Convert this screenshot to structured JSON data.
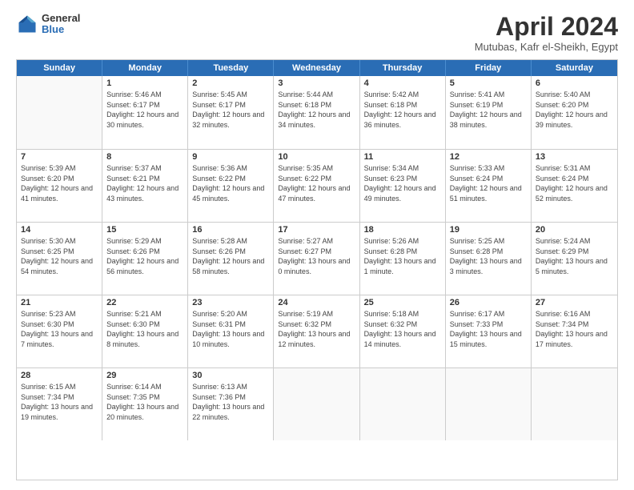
{
  "logo": {
    "general": "General",
    "blue": "Blue"
  },
  "title": "April 2024",
  "subtitle": "Mutubas, Kafr el-Sheikh, Egypt",
  "days": [
    "Sunday",
    "Monday",
    "Tuesday",
    "Wednesday",
    "Thursday",
    "Friday",
    "Saturday"
  ],
  "weeks": [
    [
      {
        "day": "",
        "sunrise": "",
        "sunset": "",
        "daylight": ""
      },
      {
        "day": "1",
        "sunrise": "Sunrise: 5:46 AM",
        "sunset": "Sunset: 6:17 PM",
        "daylight": "Daylight: 12 hours and 30 minutes."
      },
      {
        "day": "2",
        "sunrise": "Sunrise: 5:45 AM",
        "sunset": "Sunset: 6:17 PM",
        "daylight": "Daylight: 12 hours and 32 minutes."
      },
      {
        "day": "3",
        "sunrise": "Sunrise: 5:44 AM",
        "sunset": "Sunset: 6:18 PM",
        "daylight": "Daylight: 12 hours and 34 minutes."
      },
      {
        "day": "4",
        "sunrise": "Sunrise: 5:42 AM",
        "sunset": "Sunset: 6:18 PM",
        "daylight": "Daylight: 12 hours and 36 minutes."
      },
      {
        "day": "5",
        "sunrise": "Sunrise: 5:41 AM",
        "sunset": "Sunset: 6:19 PM",
        "daylight": "Daylight: 12 hours and 38 minutes."
      },
      {
        "day": "6",
        "sunrise": "Sunrise: 5:40 AM",
        "sunset": "Sunset: 6:20 PM",
        "daylight": "Daylight: 12 hours and 39 minutes."
      }
    ],
    [
      {
        "day": "7",
        "sunrise": "Sunrise: 5:39 AM",
        "sunset": "Sunset: 6:20 PM",
        "daylight": "Daylight: 12 hours and 41 minutes."
      },
      {
        "day": "8",
        "sunrise": "Sunrise: 5:37 AM",
        "sunset": "Sunset: 6:21 PM",
        "daylight": "Daylight: 12 hours and 43 minutes."
      },
      {
        "day": "9",
        "sunrise": "Sunrise: 5:36 AM",
        "sunset": "Sunset: 6:22 PM",
        "daylight": "Daylight: 12 hours and 45 minutes."
      },
      {
        "day": "10",
        "sunrise": "Sunrise: 5:35 AM",
        "sunset": "Sunset: 6:22 PM",
        "daylight": "Daylight: 12 hours and 47 minutes."
      },
      {
        "day": "11",
        "sunrise": "Sunrise: 5:34 AM",
        "sunset": "Sunset: 6:23 PM",
        "daylight": "Daylight: 12 hours and 49 minutes."
      },
      {
        "day": "12",
        "sunrise": "Sunrise: 5:33 AM",
        "sunset": "Sunset: 6:24 PM",
        "daylight": "Daylight: 12 hours and 51 minutes."
      },
      {
        "day": "13",
        "sunrise": "Sunrise: 5:31 AM",
        "sunset": "Sunset: 6:24 PM",
        "daylight": "Daylight: 12 hours and 52 minutes."
      }
    ],
    [
      {
        "day": "14",
        "sunrise": "Sunrise: 5:30 AM",
        "sunset": "Sunset: 6:25 PM",
        "daylight": "Daylight: 12 hours and 54 minutes."
      },
      {
        "day": "15",
        "sunrise": "Sunrise: 5:29 AM",
        "sunset": "Sunset: 6:26 PM",
        "daylight": "Daylight: 12 hours and 56 minutes."
      },
      {
        "day": "16",
        "sunrise": "Sunrise: 5:28 AM",
        "sunset": "Sunset: 6:26 PM",
        "daylight": "Daylight: 12 hours and 58 minutes."
      },
      {
        "day": "17",
        "sunrise": "Sunrise: 5:27 AM",
        "sunset": "Sunset: 6:27 PM",
        "daylight": "Daylight: 13 hours and 0 minutes."
      },
      {
        "day": "18",
        "sunrise": "Sunrise: 5:26 AM",
        "sunset": "Sunset: 6:28 PM",
        "daylight": "Daylight: 13 hours and 1 minute."
      },
      {
        "day": "19",
        "sunrise": "Sunrise: 5:25 AM",
        "sunset": "Sunset: 6:28 PM",
        "daylight": "Daylight: 13 hours and 3 minutes."
      },
      {
        "day": "20",
        "sunrise": "Sunrise: 5:24 AM",
        "sunset": "Sunset: 6:29 PM",
        "daylight": "Daylight: 13 hours and 5 minutes."
      }
    ],
    [
      {
        "day": "21",
        "sunrise": "Sunrise: 5:23 AM",
        "sunset": "Sunset: 6:30 PM",
        "daylight": "Daylight: 13 hours and 7 minutes."
      },
      {
        "day": "22",
        "sunrise": "Sunrise: 5:21 AM",
        "sunset": "Sunset: 6:30 PM",
        "daylight": "Daylight: 13 hours and 8 minutes."
      },
      {
        "day": "23",
        "sunrise": "Sunrise: 5:20 AM",
        "sunset": "Sunset: 6:31 PM",
        "daylight": "Daylight: 13 hours and 10 minutes."
      },
      {
        "day": "24",
        "sunrise": "Sunrise: 5:19 AM",
        "sunset": "Sunset: 6:32 PM",
        "daylight": "Daylight: 13 hours and 12 minutes."
      },
      {
        "day": "25",
        "sunrise": "Sunrise: 5:18 AM",
        "sunset": "Sunset: 6:32 PM",
        "daylight": "Daylight: 13 hours and 14 minutes."
      },
      {
        "day": "26",
        "sunrise": "Sunrise: 6:17 AM",
        "sunset": "Sunset: 7:33 PM",
        "daylight": "Daylight: 13 hours and 15 minutes."
      },
      {
        "day": "27",
        "sunrise": "Sunrise: 6:16 AM",
        "sunset": "Sunset: 7:34 PM",
        "daylight": "Daylight: 13 hours and 17 minutes."
      }
    ],
    [
      {
        "day": "28",
        "sunrise": "Sunrise: 6:15 AM",
        "sunset": "Sunset: 7:34 PM",
        "daylight": "Daylight: 13 hours and 19 minutes."
      },
      {
        "day": "29",
        "sunrise": "Sunrise: 6:14 AM",
        "sunset": "Sunset: 7:35 PM",
        "daylight": "Daylight: 13 hours and 20 minutes."
      },
      {
        "day": "30",
        "sunrise": "Sunrise: 6:13 AM",
        "sunset": "Sunset: 7:36 PM",
        "daylight": "Daylight: 13 hours and 22 minutes."
      },
      {
        "day": "",
        "sunrise": "",
        "sunset": "",
        "daylight": ""
      },
      {
        "day": "",
        "sunrise": "",
        "sunset": "",
        "daylight": ""
      },
      {
        "day": "",
        "sunrise": "",
        "sunset": "",
        "daylight": ""
      },
      {
        "day": "",
        "sunrise": "",
        "sunset": "",
        "daylight": ""
      }
    ]
  ]
}
